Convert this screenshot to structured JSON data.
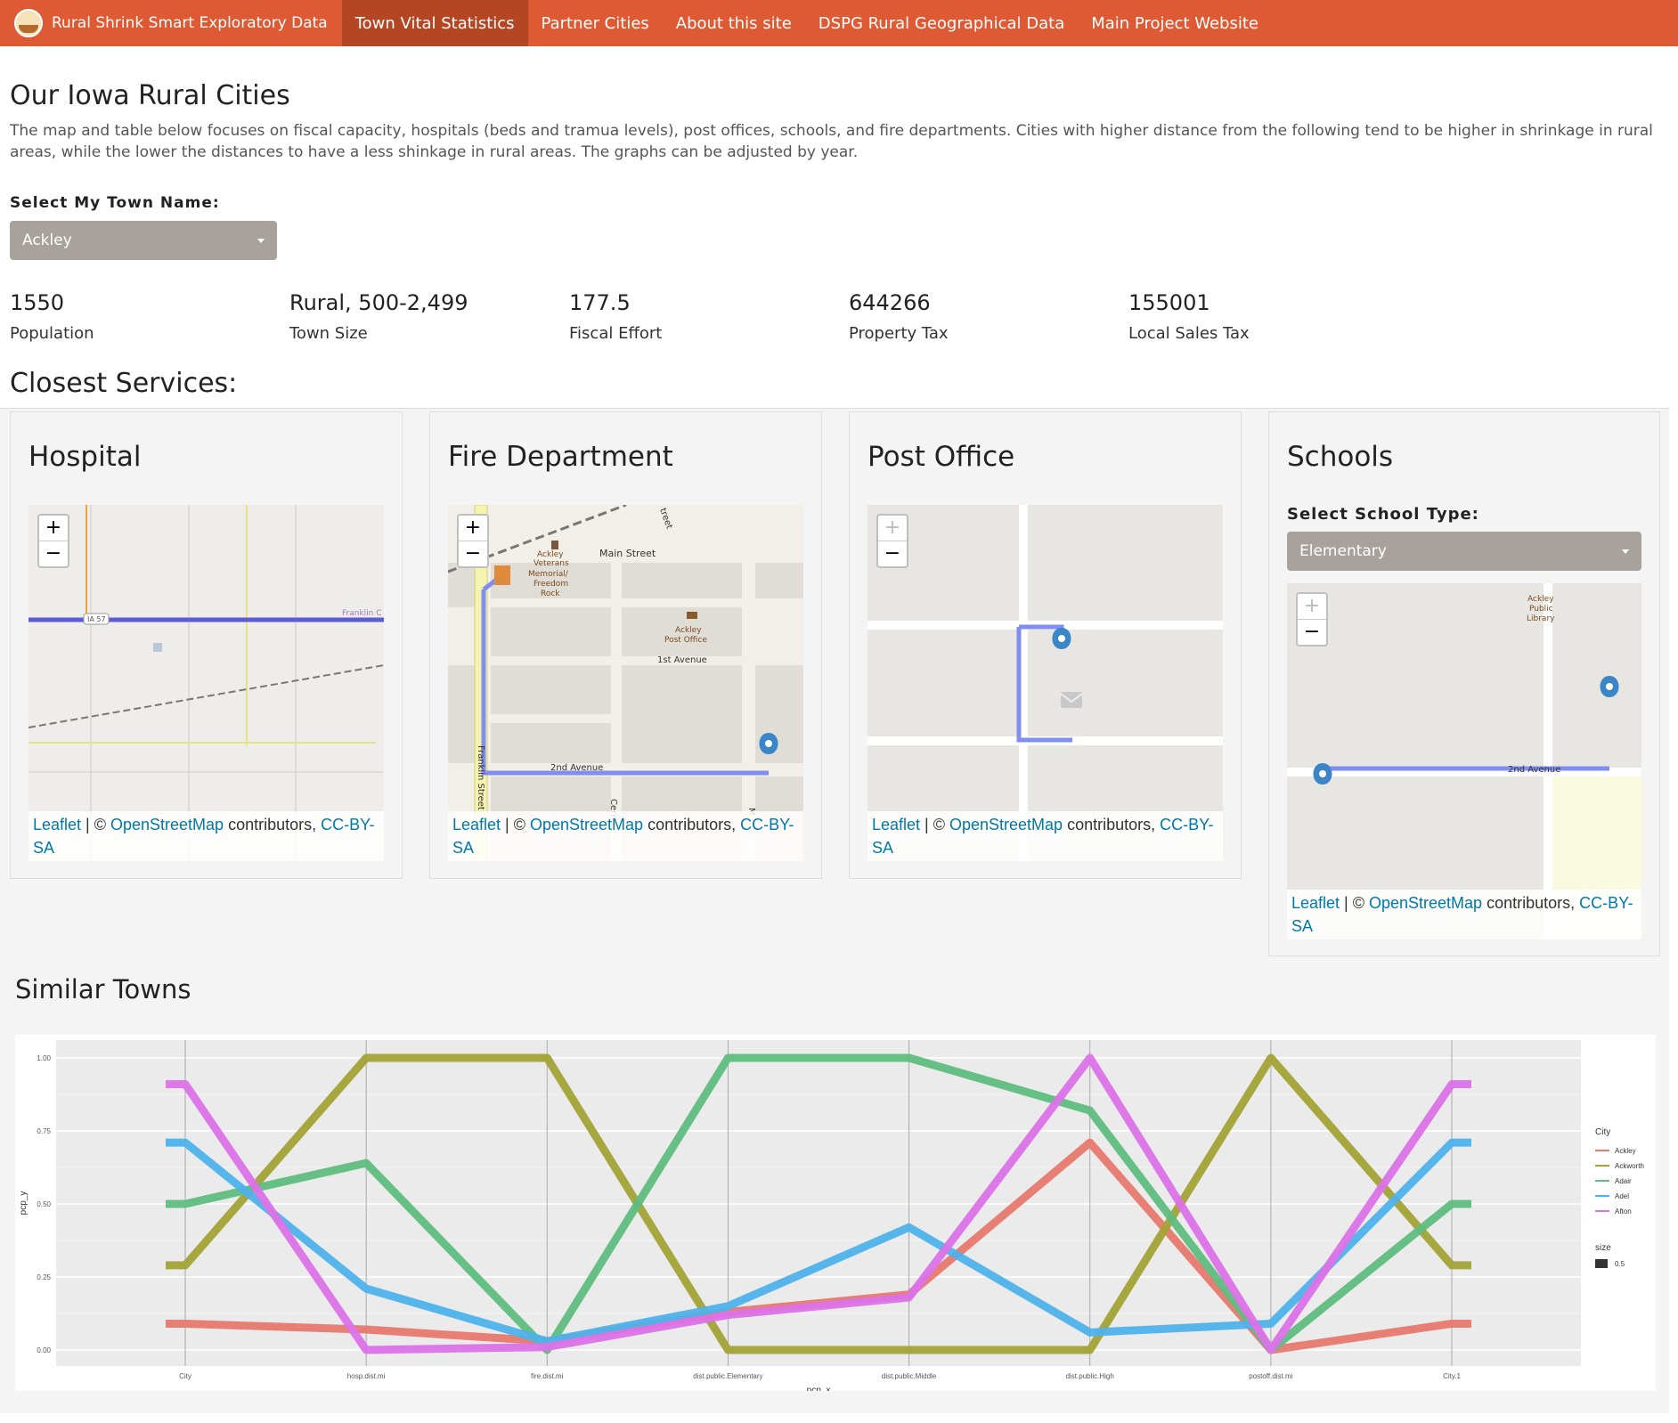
{
  "navbar": {
    "brand": "Rural Shrink Smart Exploratory Data",
    "items": [
      {
        "label": "Town Vital Statistics",
        "active": true
      },
      {
        "label": "Partner Cities",
        "active": false
      },
      {
        "label": "About this site",
        "active": false
      },
      {
        "label": "DSPG Rural Geographical Data",
        "active": false
      },
      {
        "label": "Main Project Website",
        "active": false
      }
    ]
  },
  "page": {
    "title": "Our Iowa Rural Cities",
    "intro": "The map and table below focuses on fiscal capacity, hospitals (beds and tramua levels), post offices, schools, and fire departments. Cities with higher distance from the following tend to be higher in shrinkage in rural areas, while the lower the distances to have a less shinkage in rural areas. The graphs can be adjusted by year.",
    "town_select_label": "Select My Town Name:",
    "town_selected": "Ackley"
  },
  "stats": [
    {
      "value": "1550",
      "label": "Population"
    },
    {
      "value": "Rural, 500-2,499",
      "label": "Town Size"
    },
    {
      "value": "177.5",
      "label": "Fiscal Effort"
    },
    {
      "value": "644266",
      "label": "Property Tax"
    },
    {
      "value": "155001",
      "label": "Local Sales Tax"
    }
  ],
  "services": {
    "title": "Closest Services:",
    "hospital": {
      "title": "Hospital",
      "map_labels": [
        "IA 57",
        "Franklin C"
      ]
    },
    "fire": {
      "title": "Fire Department",
      "map_labels": [
        "Main Street",
        "Ackley",
        "Veterans",
        "Memorial/",
        "Freedom",
        "Rock",
        "Ackley",
        "Post Office",
        "1st Avenue",
        "2nd Avenue",
        "Franklin Street",
        "treet",
        "Cerr",
        "M"
      ]
    },
    "post_office": {
      "title": "Post Office"
    },
    "schools": {
      "title": "Schools",
      "select_label": "Select School Type:",
      "selected": "Elementary",
      "map_labels": [
        "Ackley",
        "Public",
        "Library",
        "2nd Avenue"
      ]
    },
    "zoom_in": "+",
    "zoom_out": "−"
  },
  "attribution": {
    "leaflet": "Leaflet",
    "sep": " | © ",
    "osm": "OpenStreetMap",
    "contrib": " contributors, ",
    "license": "CC-BY-SA"
  },
  "similar": {
    "title": "Similar Towns"
  },
  "chart_data": {
    "type": "line",
    "xlabel": "pcp_x",
    "ylabel": "pcp_y",
    "categories": [
      "City",
      "hosp.dist.mi",
      "fire.dist.mi",
      "dist.public.Elementary",
      "dist.public.Middle",
      "dist.public.High",
      "postoff.dist.mi",
      "City.1"
    ],
    "ylim": [
      0,
      1
    ],
    "yticks": [
      "0.00",
      "0.25",
      "0.50",
      "0.75",
      "1.00"
    ],
    "legend_title": "City",
    "legend_position": "right",
    "size_legend_title": "size",
    "size_legend_value": "0.5",
    "series": [
      {
        "name": "Ackley",
        "color": "#e8796e",
        "values": [
          0.09,
          0.07,
          0.03,
          0.13,
          0.19,
          0.71,
          0.0,
          0.09
        ]
      },
      {
        "name": "Ackworth",
        "color": "#a3a336",
        "values": [
          0.29,
          1.0,
          1.0,
          0.0,
          0.0,
          0.0,
          1.0,
          0.29
        ]
      },
      {
        "name": "Adair",
        "color": "#5fbd7f",
        "values": [
          0.5,
          0.64,
          0.0,
          1.0,
          1.0,
          0.82,
          0.0,
          0.5
        ]
      },
      {
        "name": "Adel",
        "color": "#4eb2ea",
        "values": [
          0.71,
          0.21,
          0.03,
          0.15,
          0.42,
          0.06,
          0.09,
          0.71
        ]
      },
      {
        "name": "Afton",
        "color": "#dc72e8",
        "values": [
          0.91,
          0.0,
          0.01,
          0.12,
          0.18,
          1.0,
          0.0,
          0.91
        ]
      }
    ]
  }
}
